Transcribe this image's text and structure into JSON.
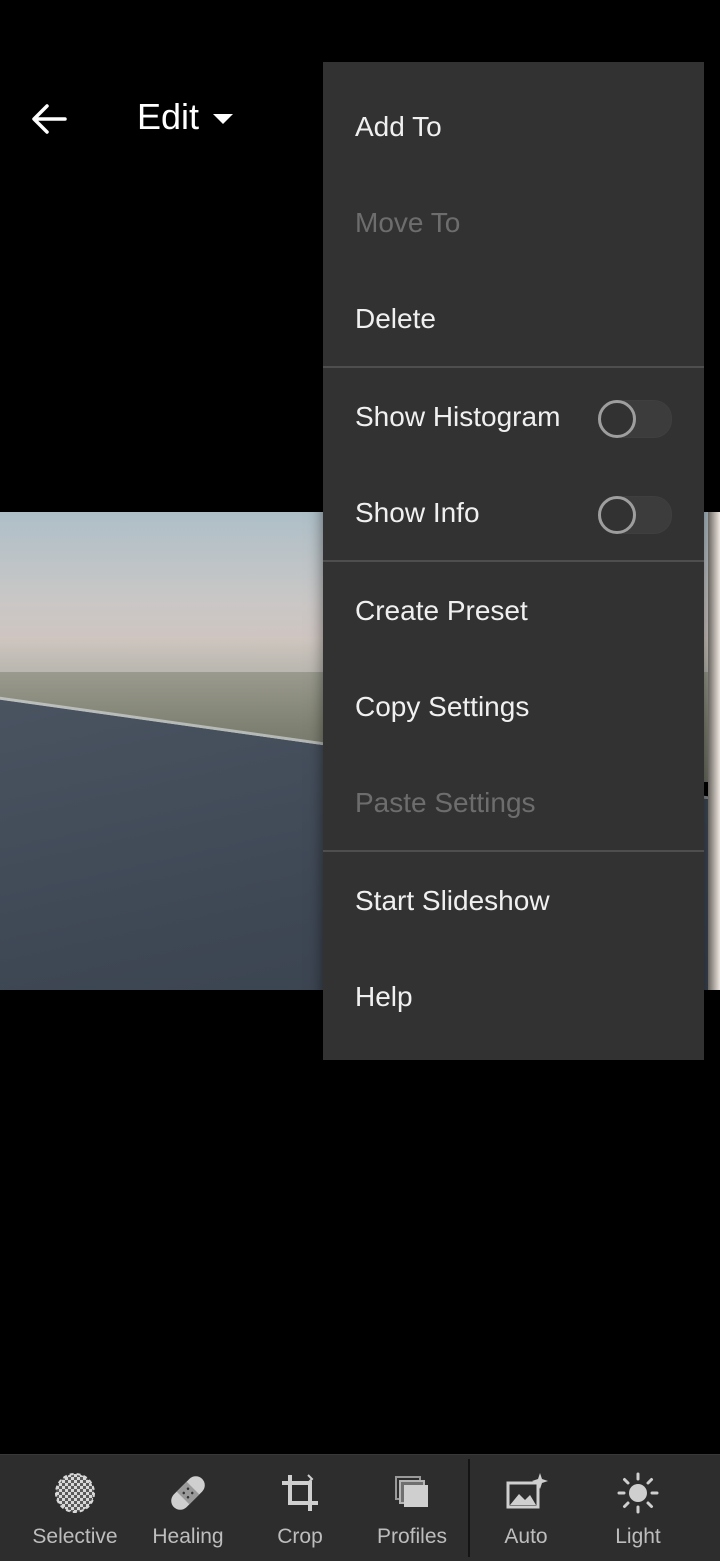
{
  "header": {
    "back_icon": "arrow-left-icon",
    "title": "Edit",
    "title_icon": "caret-down-icon"
  },
  "menu": {
    "items": [
      {
        "label": "Add To",
        "enabled": true
      },
      {
        "label": "Move To",
        "enabled": false
      },
      {
        "label": "Delete",
        "enabled": true
      },
      {
        "label": "Show Histogram",
        "enabled": true,
        "toggle": false
      },
      {
        "label": "Show Info",
        "enabled": true,
        "toggle": false
      },
      {
        "label": "Create Preset",
        "enabled": true
      },
      {
        "label": "Copy Settings",
        "enabled": true
      },
      {
        "label": "Paste Settings",
        "enabled": false
      },
      {
        "label": "Start Slideshow",
        "enabled": true
      },
      {
        "label": "Help",
        "enabled": true
      }
    ]
  },
  "toolbar": {
    "tools": [
      {
        "label": "Selective",
        "icon": "selective-icon"
      },
      {
        "label": "Healing",
        "icon": "bandage-icon"
      },
      {
        "label": "Crop",
        "icon": "crop-icon"
      },
      {
        "label": "Profiles",
        "icon": "profiles-icon"
      },
      {
        "label": "Auto",
        "icon": "auto-icon"
      },
      {
        "label": "Light",
        "icon": "sun-icon"
      }
    ]
  },
  "colors": {
    "background": "#000000",
    "menu_bg": "#323232",
    "text": "#f0f0f0",
    "disabled_text": "#6d6d6d",
    "toolbar_bg": "#2d2d2d"
  }
}
